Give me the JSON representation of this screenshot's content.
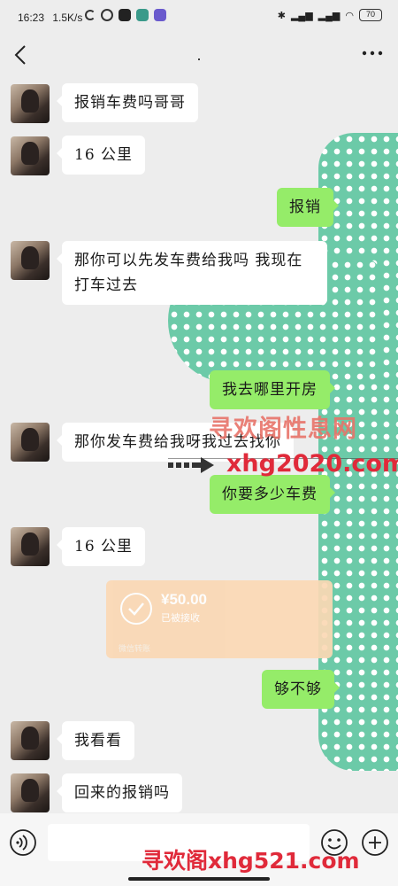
{
  "status_bar": {
    "time": "16:23",
    "speed": "1.5K/s",
    "battery": "70"
  },
  "header": {
    "title": "."
  },
  "messages": [
    {
      "side": "in",
      "text": "报销车费吗哥哥"
    },
    {
      "side": "in",
      "text": "16 公里"
    },
    {
      "side": "out",
      "text": "报销"
    },
    {
      "side": "in",
      "text": "那你可以先发车费给我吗 我现在打车过去"
    },
    {
      "side": "out",
      "text": "我去哪里开房"
    },
    {
      "side": "in",
      "text": "那你发车费给我呀我过去找你"
    },
    {
      "side": "out",
      "text": "你要多少车费"
    },
    {
      "side": "in",
      "text": "16 公里"
    },
    {
      "side": "out",
      "text": "够不够"
    },
    {
      "side": "in",
      "text": "我看看"
    },
    {
      "side": "in",
      "text": "回来的报销吗"
    }
  ],
  "transfer": {
    "amount": "¥50.00",
    "status": "已被接收",
    "footer": "微信转账"
  },
  "watermark": {
    "line1": "寻欢阁性息网",
    "line2": "xhg2020.com",
    "bottom": "寻欢阁xhg521.com"
  },
  "colors": {
    "out_bubble": "#95ec69",
    "in_bubble": "#ffffff",
    "background": "#ededed",
    "dots": "#6ccaa8",
    "transfer": "#fbd8b4"
  }
}
